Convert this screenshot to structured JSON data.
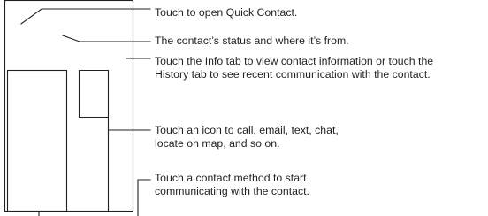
{
  "callouts": {
    "quick_contact": [
      "Touch to open Quick Contact."
    ],
    "status": [
      "The contact’s status and where it’s from."
    ],
    "tabs": [
      "Touch the Info tab to view contact information or touch the",
      "History tab to see recent communication with the contact."
    ],
    "icons": [
      "Touch an icon to call, email, text, chat,",
      "locate on map, and so on."
    ],
    "methods": [
      "Touch a contact method to start",
      "communicating with the contact."
    ]
  },
  "colors": {
    "ink": "#231f20",
    "background": "#ffffff"
  }
}
